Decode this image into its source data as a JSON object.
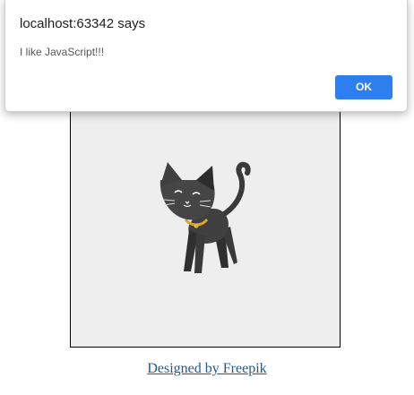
{
  "dialog": {
    "title": "localhost:63342 says",
    "message": "I like JavaScript!!!",
    "ok_label": "OK",
    "ok_color": "#2d7ff0"
  },
  "page": {
    "image": {
      "subject_icon": "black-cat-illustration",
      "background_color": "#eeeeee"
    },
    "credit_link": "Designed by Freepik"
  }
}
